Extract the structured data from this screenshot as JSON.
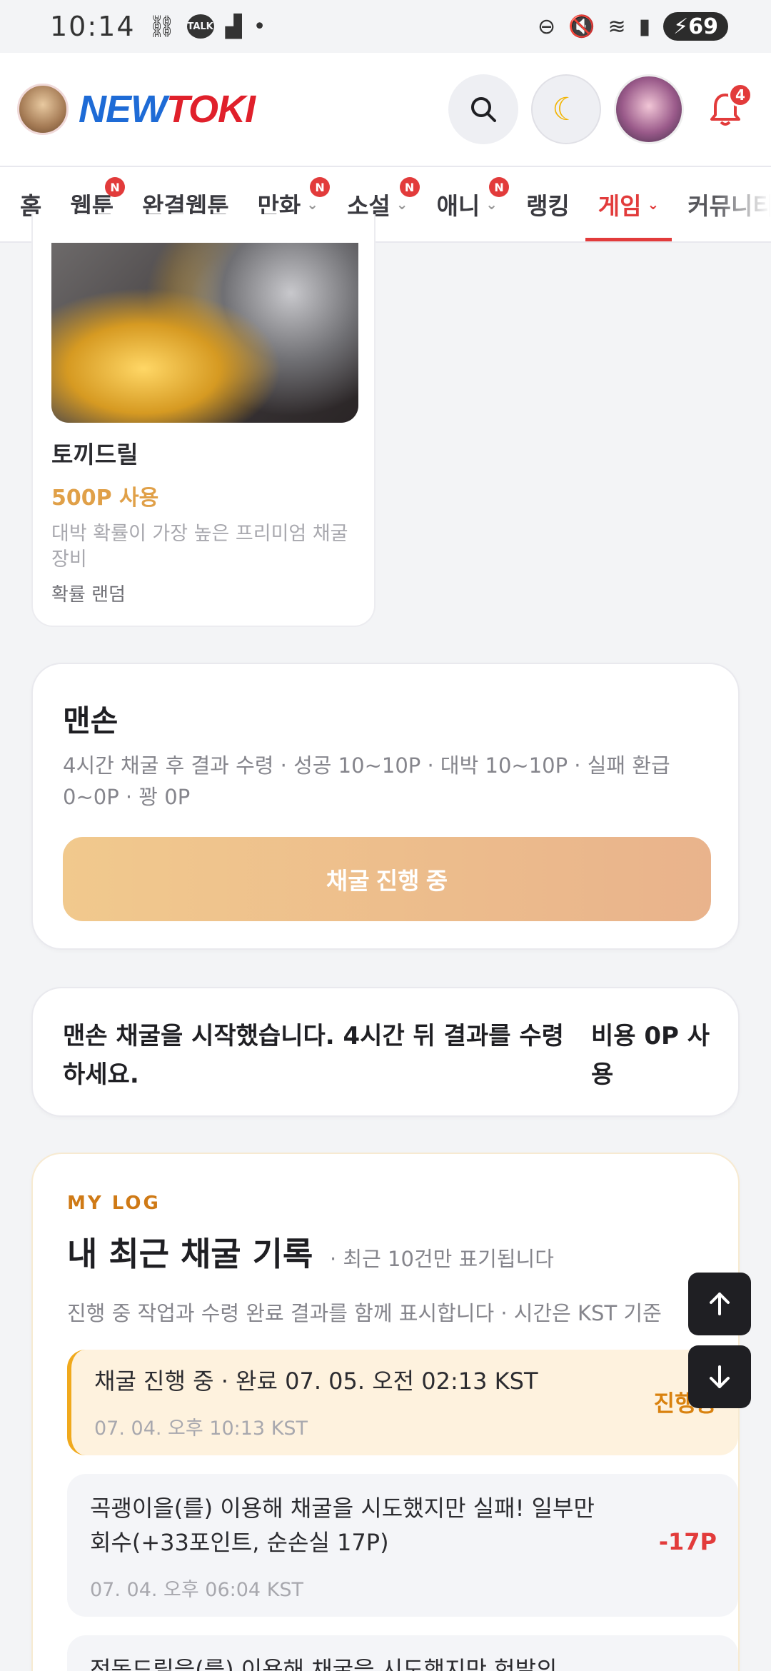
{
  "status_bar": {
    "time": "10:14",
    "battery": "69",
    "talk_badge": "TALK"
  },
  "header": {
    "logo_part1": "NEW",
    "logo_part2": "TOKI",
    "notification_count": "4"
  },
  "nav": {
    "items": [
      {
        "label": "홈",
        "badge": "",
        "chevron": false
      },
      {
        "label": "웹툰",
        "badge": "N",
        "chevron": false
      },
      {
        "label": "완결웹툰",
        "badge": "",
        "chevron": false
      },
      {
        "label": "만화",
        "badge": "N",
        "chevron": true
      },
      {
        "label": "소설",
        "badge": "N",
        "chevron": true
      },
      {
        "label": "애니",
        "badge": "N",
        "chevron": true
      },
      {
        "label": "랭킹",
        "badge": "",
        "chevron": false
      },
      {
        "label": "게임",
        "badge": "",
        "chevron": true,
        "active": true
      },
      {
        "label": "커뮤니티",
        "badge": "",
        "chevron": false
      }
    ]
  },
  "item_card": {
    "name": "토끼드릴",
    "cost": "500P 사용",
    "description": "대박 확률이 가장 높은 프리미엄 채굴 장비",
    "probability": "확률 랜덤"
  },
  "mining": {
    "title": "맨손",
    "description": "4시간 채굴 후 결과 수령 · 성공 10~10P · 대박 10~10P · 실패 환급 0~0P · 꽝 0P",
    "button_label": "채굴 진행 중"
  },
  "notice": {
    "message": "맨손 채굴을 시작했습니다. 4시간 뒤 결과를 수령하세요.",
    "cost": "비용 0P 사용"
  },
  "log": {
    "eyebrow": "MY LOG",
    "title": "내 최근 채굴 기록",
    "subtitle": "· 최근 10건만 표기됩니다",
    "help": "진행 중 작업과 수령 완료 결과를 함께 표시합니다 · 시간은 KST 기준",
    "entries": [
      {
        "text": "채굴 진행 중 · 완료 07. 05. 오전 02:13 KST",
        "time": "07. 04. 오후 10:13 KST",
        "status": "진행중",
        "status_color": "#d9820f"
      },
      {
        "text": "곡괭이을(를) 이용해 채굴을 시도했지만 실패! 일부만 회수(+33포인트, 순손실 17P)",
        "time": "07. 04. 오후 06:04 KST",
        "status": "-17P",
        "status_color": "#e23b3b"
      },
      {
        "text": "전동드릴을(를) 이용해 채굴을 시도했지만 헛발의",
        "time": "",
        "status": "",
        "status_color": "#e23b3b"
      }
    ]
  },
  "colors": {
    "accent_red": "#e23b3b",
    "accent_orange": "#cf7a16",
    "button_gradient_start": "#f1c98d",
    "button_gradient_end": "#e9b38c"
  }
}
